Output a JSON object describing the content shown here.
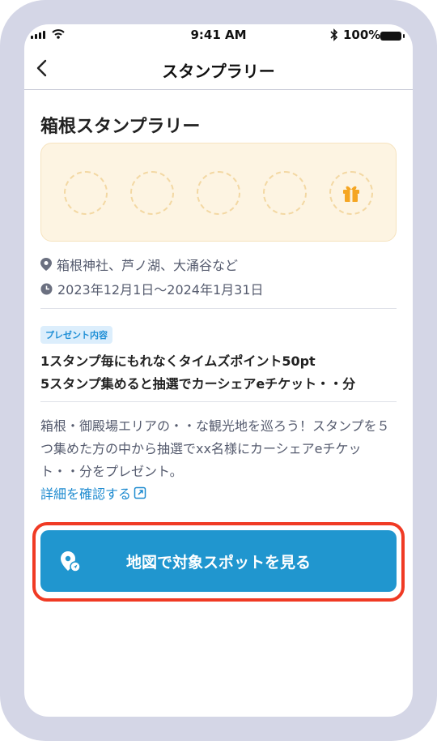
{
  "status": {
    "time": "9:41 AM",
    "battery": "100%"
  },
  "nav": {
    "title": "スタンプラリー"
  },
  "card": {
    "title": "箱根スタンプラリー",
    "stamps_collected": 0,
    "stamps_total": 5
  },
  "info": {
    "location": "箱根神社、芦ノ湖、大涌谷など",
    "period": "2023年12月1日〜2024年1月31日"
  },
  "present": {
    "badge": "プレゼント内容",
    "line1": "1スタンプ毎にもれなくタイムズポイント50pt",
    "line2": "5スタンプ集めると抽選でカーシェアeチケット・・分"
  },
  "description": {
    "text": "箱根・御殿場エリアの・・な観光地を巡ろう！スタンプを５つ集めた方の中から抽選でxx名様にカーシェアeチケット・・分をプレゼント。",
    "link": "詳細を確認する"
  },
  "action": {
    "label": "地図で対象スポットを見る"
  },
  "colors": {
    "primary": "#2096cf",
    "highlight": "#f03a24",
    "stamp_bg": "#fdf4e2",
    "stamp_dash": "#f3d8a3"
  }
}
